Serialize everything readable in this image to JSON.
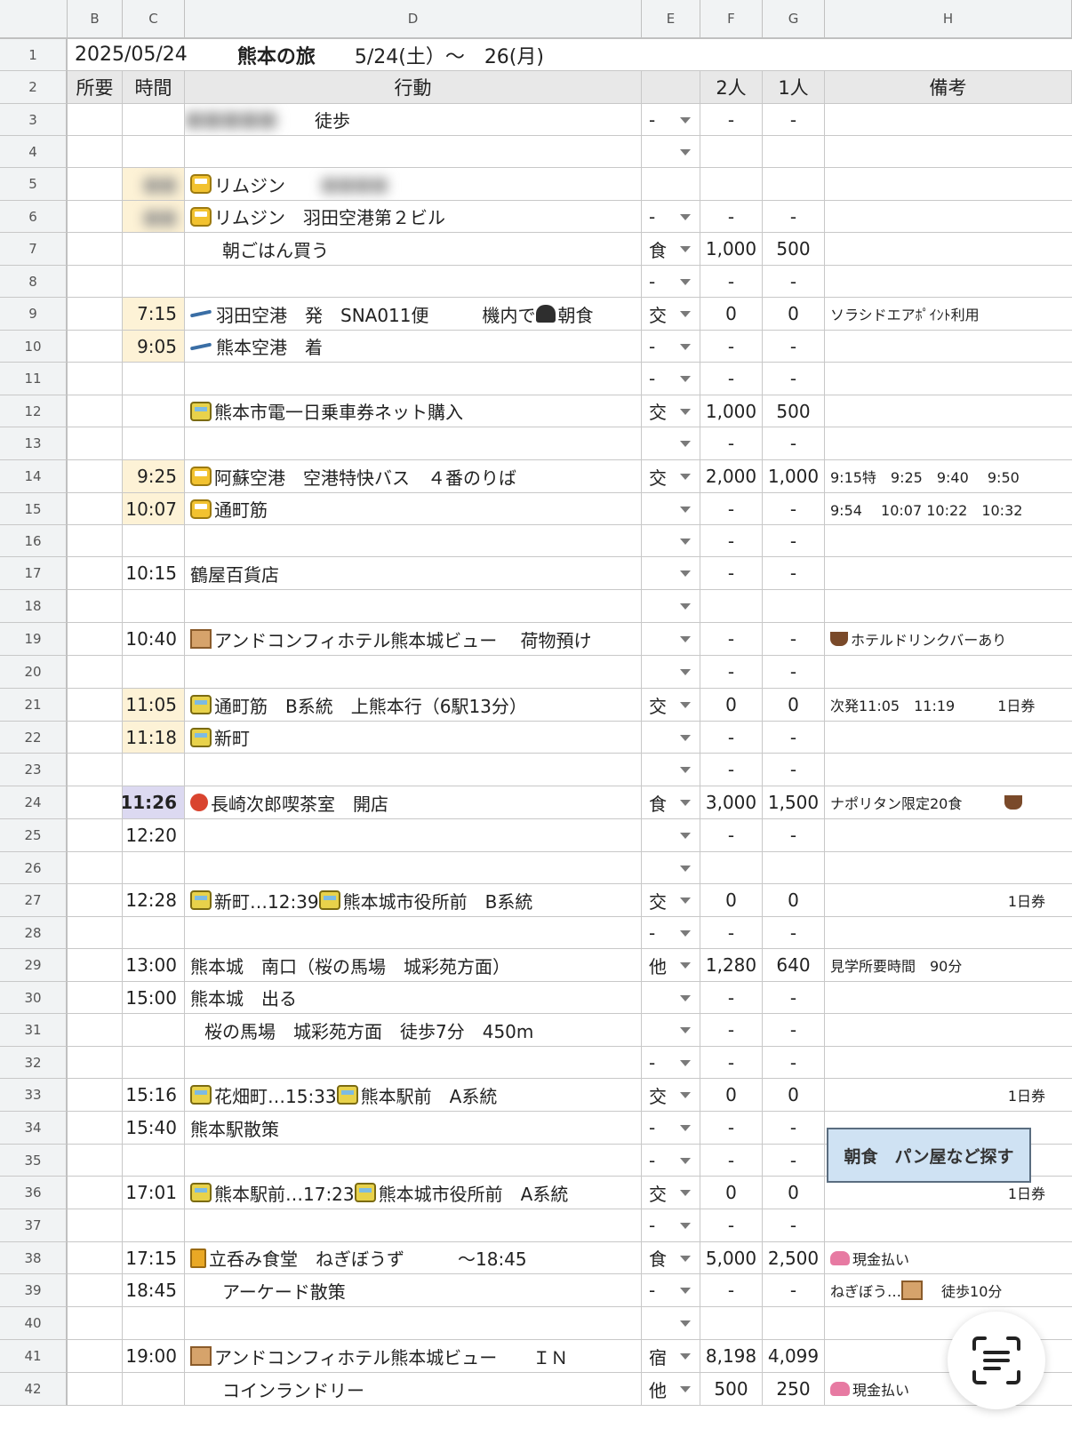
{
  "columns": [
    "B",
    "C",
    "D",
    "E",
    "F",
    "G",
    "H"
  ],
  "title_row": {
    "date": "2025/05/24",
    "trip_title": "熊本の旅",
    "period": "5/24(土）～　26(月)"
  },
  "header_row": {
    "duration": "所要",
    "time": "時間",
    "action": "行動",
    "cat": "",
    "two": "2人",
    "one": "1人",
    "note": "備考"
  },
  "rows": [
    {
      "n": "3",
      "time": "",
      "hl": "",
      "icon": "",
      "action": "徒歩",
      "indent": "far",
      "blur_action": true,
      "cat": "-",
      "dd": true,
      "two": "-",
      "one": "-",
      "note": "",
      "note_icon": ""
    },
    {
      "n": "4",
      "time": "",
      "hl": "",
      "icon": "",
      "action": "",
      "indent": "",
      "blur_action": false,
      "cat": "",
      "dd": true,
      "two": "",
      "one": "",
      "note": "",
      "note_icon": ""
    },
    {
      "n": "5",
      "time": "",
      "hl": "time-hl",
      "icon": "bus",
      "action": "リムジン",
      "indent": "",
      "blur_action": false,
      "blur_tail": true,
      "cat": "",
      "dd": false,
      "two": "",
      "one": "",
      "note": "",
      "note_icon": ""
    },
    {
      "n": "6",
      "time": "",
      "hl": "time-hl",
      "icon": "bus",
      "action": "リムジン　羽田空港第２ビル",
      "indent": "",
      "blur_action": false,
      "cat": "-",
      "dd": true,
      "two": "-",
      "one": "-",
      "note": "",
      "note_icon": ""
    },
    {
      "n": "7",
      "time": "",
      "hl": "",
      "icon": "",
      "action": "朝ごはん買う",
      "indent": "mid",
      "blur_action": false,
      "cat": "食",
      "dd": true,
      "two": "1,000",
      "one": "500",
      "note": "",
      "note_icon": ""
    },
    {
      "n": "8",
      "time": "",
      "hl": "",
      "icon": "",
      "action": "",
      "indent": "",
      "blur_action": false,
      "cat": "-",
      "dd": true,
      "two": "-",
      "one": "-",
      "note": "",
      "note_icon": ""
    },
    {
      "n": "9",
      "time": "7:15",
      "hl": "time-hl",
      "icon": "plane",
      "action": "羽田空港　発　SNA011便　　　機内で",
      "action_tail": "朝食",
      "tail_icon": "onigiri",
      "indent": "",
      "blur_action": false,
      "cat": "交",
      "dd": true,
      "two": "0",
      "one": "0",
      "note": "ソラシドエアﾎﾟｲﾝﾄ利用",
      "note_icon": ""
    },
    {
      "n": "10",
      "time": "9:05",
      "hl": "time-hl",
      "icon": "plane",
      "action": "熊本空港　着",
      "indent": "",
      "blur_action": false,
      "cat": "-",
      "dd": true,
      "two": "-",
      "one": "-",
      "note": "",
      "note_icon": ""
    },
    {
      "n": "11",
      "time": "",
      "hl": "",
      "icon": "",
      "action": "",
      "indent": "",
      "blur_action": false,
      "cat": "-",
      "dd": true,
      "two": "-",
      "one": "-",
      "note": "",
      "note_icon": ""
    },
    {
      "n": "12",
      "time": "",
      "hl": "",
      "icon": "tram",
      "action": "熊本市電一日乗車券ネット購入",
      "indent": "",
      "blur_action": false,
      "cat": "交",
      "dd": true,
      "two": "1,000",
      "one": "500",
      "note": "",
      "note_icon": ""
    },
    {
      "n": "13",
      "time": "",
      "hl": "",
      "icon": "",
      "action": "",
      "indent": "",
      "blur_action": false,
      "cat": "",
      "dd": true,
      "two": "-",
      "one": "-",
      "note": "",
      "note_icon": ""
    },
    {
      "n": "14",
      "time": "9:25",
      "hl": "time-hl",
      "icon": "bus",
      "action": "阿蘇空港　空港特快バス　４番のりば",
      "indent": "",
      "blur_action": false,
      "cat": "交",
      "dd": true,
      "two": "2,000",
      "one": "1,000",
      "note": "9:15特　9:25　9:40　 9:50",
      "note_icon": ""
    },
    {
      "n": "15",
      "time": "10:07",
      "hl": "time-hl",
      "icon": "bus",
      "action": "通町筋",
      "indent": "",
      "blur_action": false,
      "cat": "",
      "dd": true,
      "two": "-",
      "one": "-",
      "note": "9:54　 10:07 10:22　10:32",
      "note_icon": ""
    },
    {
      "n": "16",
      "time": "",
      "hl": "",
      "icon": "",
      "action": "",
      "indent": "",
      "blur_action": false,
      "cat": "",
      "dd": true,
      "two": "-",
      "one": "-",
      "note": "",
      "note_icon": ""
    },
    {
      "n": "17",
      "time": "10:15",
      "hl": "",
      "icon": "",
      "action": "鶴屋百貨店",
      "indent": "",
      "blur_action": false,
      "cat": "",
      "dd": true,
      "two": "-",
      "one": "-",
      "note": "",
      "note_icon": ""
    },
    {
      "n": "18",
      "time": "",
      "hl": "",
      "icon": "",
      "action": "",
      "indent": "",
      "blur_action": false,
      "cat": "",
      "dd": true,
      "two": "",
      "one": "",
      "note": "",
      "note_icon": ""
    },
    {
      "n": "19",
      "time": "10:40",
      "hl": "",
      "icon": "hotel",
      "action": "アンドコンフィホテル熊本城ビュー　 荷物預け",
      "indent": "",
      "blur_action": false,
      "cat": "",
      "dd": true,
      "two": "-",
      "one": "-",
      "note": "ホテルドリンクバーあり",
      "note_icon": "cup"
    },
    {
      "n": "20",
      "time": "",
      "hl": "",
      "icon": "",
      "action": "",
      "indent": "",
      "blur_action": false,
      "cat": "",
      "dd": true,
      "two": "-",
      "one": "-",
      "note": "",
      "note_icon": ""
    },
    {
      "n": "21",
      "time": "11:05",
      "hl": "time-hl",
      "icon": "tram",
      "action": "通町筋　B系統　上熊本行（6駅13分）",
      "indent": "",
      "blur_action": false,
      "cat": "交",
      "dd": true,
      "two": "0",
      "one": "0",
      "note": "次発11:05　11:19　　　1日券",
      "note_icon": ""
    },
    {
      "n": "22",
      "time": "11:18",
      "hl": "time-hl",
      "icon": "tram",
      "action": "新町",
      "indent": "",
      "blur_action": false,
      "cat": "",
      "dd": true,
      "two": "-",
      "one": "-",
      "note": "",
      "note_icon": ""
    },
    {
      "n": "23",
      "time": "",
      "hl": "",
      "icon": "",
      "action": "",
      "indent": "",
      "blur_action": false,
      "cat": "",
      "dd": true,
      "two": "-",
      "one": "-",
      "note": "",
      "note_icon": ""
    },
    {
      "n": "24",
      "time": "11:26",
      "hl": "time-purple",
      "icon": "tomato",
      "action": "長崎次郎喫茶室　開店",
      "indent": "",
      "blur_action": false,
      "cat": "食",
      "dd": true,
      "two": "3,000",
      "one": "1,500",
      "note": "ナポリタン限定20食　　　",
      "note_icon": "",
      "note_tail_icon": "cup"
    },
    {
      "n": "25",
      "time": "12:20",
      "hl": "",
      "icon": "",
      "action": "",
      "indent": "",
      "blur_action": false,
      "cat": "",
      "dd": true,
      "two": "-",
      "one": "-",
      "note": "",
      "note_icon": ""
    },
    {
      "n": "26",
      "time": "",
      "hl": "",
      "icon": "",
      "action": "",
      "indent": "",
      "blur_action": false,
      "cat": "",
      "dd": true,
      "two": "",
      "one": "",
      "note": "",
      "note_icon": ""
    },
    {
      "n": "27",
      "time": "12:28",
      "hl": "",
      "icon": "tram",
      "action": "新町…12:39",
      "action_tail": "熊本城市役所前　B系統",
      "tail_icon": "tram",
      "indent": "",
      "blur_action": false,
      "cat": "交",
      "dd": true,
      "two": "0",
      "one": "0",
      "note": "1日券",
      "note_align": "right",
      "note_icon": ""
    },
    {
      "n": "28",
      "time": "",
      "hl": "",
      "icon": "",
      "action": "",
      "indent": "",
      "blur_action": false,
      "cat": "-",
      "dd": true,
      "two": "-",
      "one": "-",
      "note": "",
      "note_icon": ""
    },
    {
      "n": "29",
      "time": "13:00",
      "hl": "",
      "icon": "",
      "action": "熊本城　南口（桜の馬場　城彩苑方面）",
      "indent": "",
      "blur_action": false,
      "cat": "他",
      "dd": true,
      "two": "1,280",
      "one": "640",
      "note": "見学所要時間　90分",
      "note_icon": ""
    },
    {
      "n": "30",
      "time": "15:00",
      "hl": "",
      "icon": "",
      "action": "熊本城　出る",
      "indent": "",
      "blur_action": false,
      "cat": "",
      "dd": true,
      "two": "-",
      "one": "-",
      "note": "",
      "note_icon": ""
    },
    {
      "n": "31",
      "time": "",
      "hl": "",
      "icon": "",
      "action": "桜の馬場　城彩苑方面　徒歩7分　450m",
      "indent": "small",
      "blur_action": false,
      "cat": "",
      "dd": true,
      "two": "-",
      "one": "-",
      "note": "",
      "note_icon": ""
    },
    {
      "n": "32",
      "time": "",
      "hl": "",
      "icon": "",
      "action": "",
      "indent": "",
      "blur_action": false,
      "cat": "-",
      "dd": true,
      "two": "-",
      "one": "-",
      "note": "",
      "note_icon": ""
    },
    {
      "n": "33",
      "time": "15:16",
      "hl": "",
      "icon": "tram",
      "action": "花畑町…15:33",
      "action_tail": "熊本駅前　A系統",
      "tail_icon": "tram",
      "indent": "",
      "blur_action": false,
      "cat": "交",
      "dd": true,
      "two": "0",
      "one": "0",
      "note": "1日券",
      "note_align": "right",
      "note_icon": ""
    },
    {
      "n": "34",
      "time": "15:40",
      "hl": "",
      "icon": "",
      "action": "熊本駅散策",
      "indent": "",
      "blur_action": false,
      "cat": "-",
      "dd": true,
      "two": "-",
      "one": "-",
      "note": "",
      "note_icon": ""
    },
    {
      "n": "35",
      "time": "",
      "hl": "",
      "icon": "",
      "action": "",
      "indent": "",
      "blur_action": false,
      "cat": "-",
      "dd": true,
      "two": "-",
      "one": "-",
      "note": "",
      "note_icon": ""
    },
    {
      "n": "36",
      "time": "17:01",
      "hl": "",
      "icon": "tram",
      "action": "熊本駅前…17:23",
      "action_tail": "熊本城市役所前　A系統",
      "tail_icon": "tram",
      "indent": "",
      "blur_action": false,
      "cat": "交",
      "dd": true,
      "two": "0",
      "one": "0",
      "note": "1日券",
      "note_align": "right",
      "note_icon": ""
    },
    {
      "n": "37",
      "time": "",
      "hl": "",
      "icon": "",
      "action": "",
      "indent": "",
      "blur_action": false,
      "cat": "-",
      "dd": true,
      "two": "-",
      "one": "-",
      "note": "",
      "note_icon": ""
    },
    {
      "n": "38",
      "time": "17:15",
      "hl": "",
      "icon": "beer",
      "action": "立呑み食堂　ねぎぼうず　　　～18:45",
      "indent": "",
      "blur_action": false,
      "cat": "食",
      "dd": true,
      "two": "5,000",
      "one": "2,500",
      "note": "現金払い",
      "note_icon": "purse"
    },
    {
      "n": "39",
      "time": "18:45",
      "hl": "",
      "icon": "",
      "action": "アーケード散策",
      "indent": "mid",
      "blur_action": false,
      "cat": "-",
      "dd": true,
      "two": "-",
      "one": "-",
      "note": "ねぎぼう…",
      "note_tail": "徒歩10分",
      "note_icon": "",
      "note_mid_icon": "hotel"
    },
    {
      "n": "40",
      "time": "",
      "hl": "",
      "icon": "",
      "action": "",
      "indent": "",
      "blur_action": false,
      "cat": "",
      "dd": true,
      "two": "",
      "one": "",
      "note": "",
      "note_icon": ""
    },
    {
      "n": "41",
      "time": "19:00",
      "hl": "",
      "icon": "hotel",
      "action": "アンドコンフィホテル熊本城ビュー　　ＩＮ",
      "indent": "",
      "blur_action": false,
      "cat": "宿",
      "dd": true,
      "two": "8,198",
      "one": "4,099",
      "note": "",
      "note_icon": ""
    },
    {
      "n": "42",
      "time": "",
      "hl": "",
      "icon": "",
      "action": "コインランドリー",
      "indent": "mid",
      "blur_action": false,
      "cat": "他",
      "dd": true,
      "two": "500",
      "one": "250",
      "note": "現金払い",
      "note_icon": "purse"
    }
  ],
  "note_box": {
    "label": "朝食　パン屋など探す"
  },
  "scan_button": {
    "icon": "text-scan-icon"
  }
}
